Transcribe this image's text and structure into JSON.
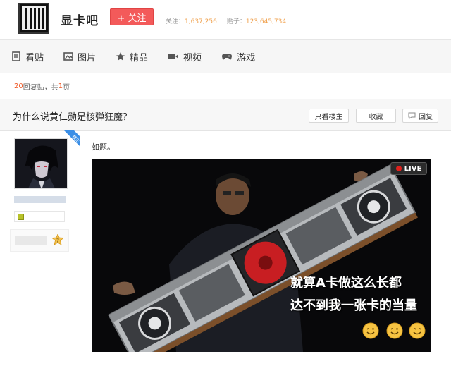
{
  "header": {
    "bar_name": "显卡吧",
    "follow_label": "+ 关注",
    "follow_label_key": "follow",
    "stats": {
      "followers_label": "关注：",
      "followers_value": "1,637,256",
      "posts_label": "贴子：",
      "posts_value": "123,645,734"
    }
  },
  "nav": {
    "items": [
      {
        "label": "看贴",
        "icon": "document-icon"
      },
      {
        "label": "图片",
        "icon": "image-icon"
      },
      {
        "label": "精品",
        "icon": "star-icon"
      },
      {
        "label": "视频",
        "icon": "video-icon"
      },
      {
        "label": "游戏",
        "icon": "gamepad-icon"
      }
    ]
  },
  "reply_info": {
    "count": "20",
    "text_mid": " 回复贴，共",
    "pages": "1",
    "text_end": "页"
  },
  "thread": {
    "title": "为什么说黄仁勋是核弹狂魔？",
    "only_op_label": "只看楼主",
    "favorite_label": "收藏",
    "reply_label": "回复"
  },
  "post": {
    "author_tag": "楼主",
    "level": "7",
    "text": "如题。",
    "image": {
      "live_label": "LIVE",
      "caption_line1": "就算A卡做这么长都",
      "caption_line2": "达不到我一张卡的当量"
    }
  },
  "colors": {
    "accent_red": "#f35a5a",
    "stat_orange": "#f0a04c",
    "reply_red": "#f05a28",
    "nav_bg": "#f6f6f6"
  }
}
